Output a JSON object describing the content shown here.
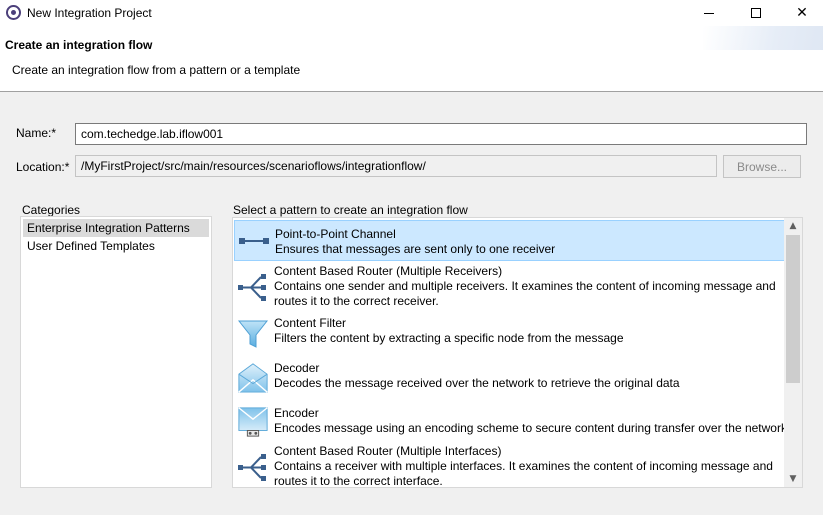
{
  "window": {
    "title": "New Integration Project",
    "app_icon": "eclipse-icon"
  },
  "header": {
    "title": "Create an integration flow",
    "description": "Create an integration flow from a pattern or a template"
  },
  "form": {
    "name_label": "Name:*",
    "name_value": "com.techedge.lab.iflow001",
    "location_label": "Location:*",
    "location_value": "/MyFirstProject/src/main/resources/scenarioflows/integrationflow/",
    "browse_label": "Browse..."
  },
  "categories": {
    "label": "Categories",
    "items": [
      {
        "label": "Enterprise Integration Patterns",
        "selected": true
      },
      {
        "label": "User Defined Templates",
        "selected": false
      }
    ]
  },
  "patterns": {
    "label": "Select a pattern to create an integration flow",
    "items": [
      {
        "title": "Point-to-Point Channel",
        "desc1": "Ensures that messages are sent only to one receiver",
        "desc2": "",
        "icon": "point-to-point-icon",
        "selected": true
      },
      {
        "title": "Content Based Router (Multiple Receivers)",
        "desc1": "Contains one sender and multiple receivers. It examines the content of incoming message and",
        "desc2": "routes it to the correct receiver.",
        "icon": "router-icon",
        "selected": false
      },
      {
        "title": "Content Filter",
        "desc1": "Filters the content by extracting a specific node from the message",
        "desc2": "",
        "icon": "filter-icon",
        "selected": false
      },
      {
        "title": "Decoder",
        "desc1": "Decodes the message received over the network to retrieve the original data",
        "desc2": "",
        "icon": "decoder-icon",
        "selected": false
      },
      {
        "title": "Encoder",
        "desc1": "Encodes message using an encoding scheme to secure content during transfer over the network",
        "desc2": "",
        "icon": "encoder-icon",
        "selected": false
      },
      {
        "title": "Content Based Router (Multiple Interfaces)",
        "desc1": "Contains a receiver with multiple interfaces. It examines the content of incoming message and",
        "desc2": "routes it to the correct interface.",
        "icon": "router-icon",
        "selected": false
      }
    ]
  },
  "colors": {
    "selection_bg": "#cce8ff",
    "selection_border": "#99d1ff",
    "icon_blue": "#2f6fb3"
  }
}
